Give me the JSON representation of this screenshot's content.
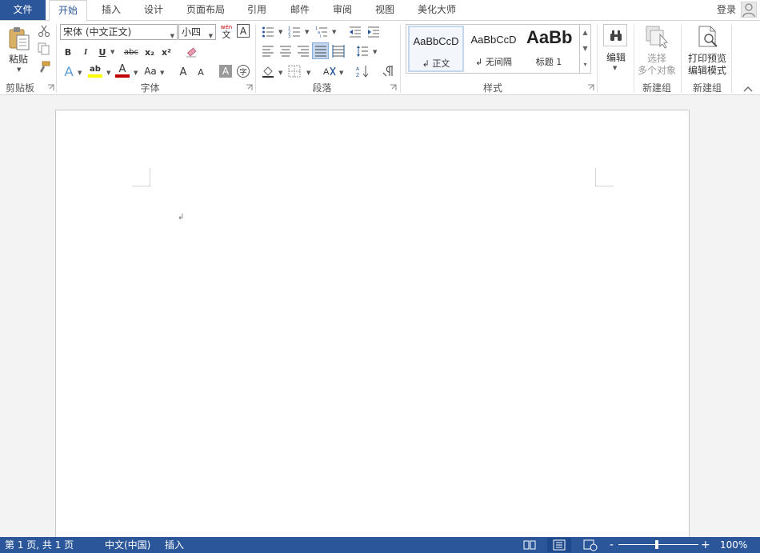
{
  "tabs": {
    "file": "文件",
    "items": [
      "开始",
      "插入",
      "设计",
      "页面布局",
      "引用",
      "邮件",
      "审阅",
      "视图",
      "美化大师"
    ],
    "active": "开始",
    "login": "登录"
  },
  "ribbon": {
    "clipboard": {
      "paste": "粘贴",
      "label": "剪贴板"
    },
    "font": {
      "name": "宋体 (中文正文)",
      "size": "小四",
      "phonetic_top": "wén",
      "phonetic_bottom": "文",
      "border_char": "A",
      "label": "字体",
      "bold": "B",
      "italic": "I",
      "underline": "U",
      "strike": "abc",
      "subscript": "x₂",
      "superscript": "x²",
      "effects": "A",
      "highlight": "ab",
      "font_color": "A",
      "change_case": "Aa",
      "grow": "A",
      "shrink": "A",
      "shade": "A",
      "enclose": "字",
      "highlight_color": "#ffff00",
      "font_color_value": "#c00000"
    },
    "paragraph": {
      "label": "段落"
    },
    "styles": {
      "label": "样式",
      "items": [
        {
          "sample": "AaBbCcD",
          "name": "↲ 正文"
        },
        {
          "sample": "AaBbCcD",
          "name": "↲ 无间隔"
        },
        {
          "sample": "AaBb",
          "name": "标题 1"
        }
      ]
    },
    "editing": {
      "label": "编辑"
    },
    "group1": {
      "line1": "选择",
      "line2": "多个对象",
      "label": "新建组"
    },
    "group2": {
      "line1": "打印预览",
      "line2": "编辑模式",
      "label": "新建组"
    }
  },
  "document": {
    "paragraph_mark": "↲"
  },
  "status": {
    "page": "第 1 页, 共 1 页",
    "language": "中文(中国)",
    "mode": "插入",
    "zoom": "100%",
    "zoom_minus": "-",
    "zoom_plus": "+"
  },
  "colors": {
    "accent": "#2b579a"
  }
}
